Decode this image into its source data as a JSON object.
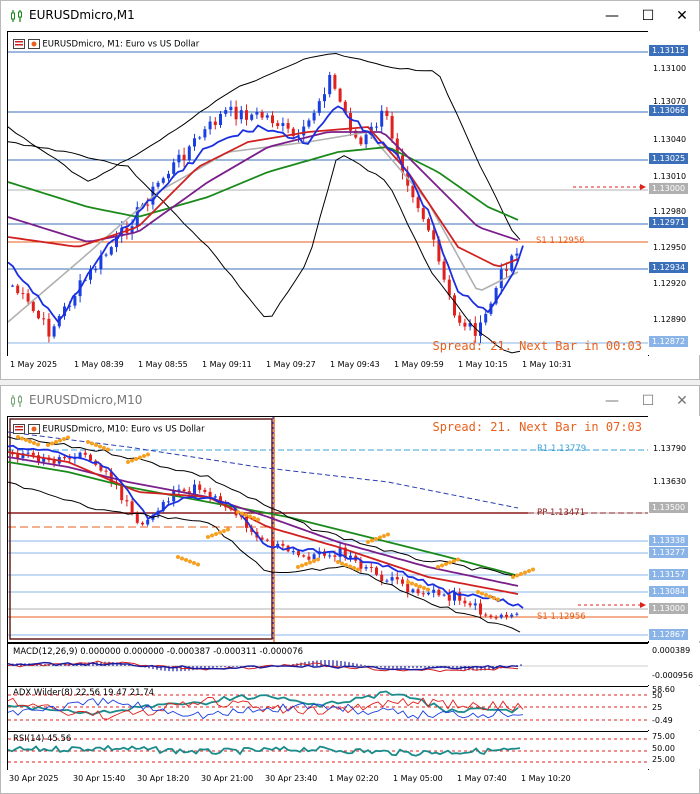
{
  "window1": {
    "title": "EURUSDmicro,M1",
    "header": "EURUSDmicro, M1:  Euro vs US Dollar",
    "spread": "Spread: 21. Next Bar in 00:03",
    "price_labels": [
      "1.13100",
      "1.13070",
      "1.13040",
      "1.13010",
      "1.12980",
      "1.12950",
      "1.12920",
      "1.12890"
    ],
    "price_tags": [
      {
        "text": "1.13115",
        "color": "#3c6fb9"
      },
      {
        "text": "1.13066",
        "color": "#3c6fb9"
      },
      {
        "text": "1.13025",
        "color": "#3c6fb9"
      },
      {
        "text": "1.13000",
        "color": "#b0b0b0"
      },
      {
        "text": "1.12971",
        "color": "#3c6fb9"
      },
      {
        "text": "1.12934",
        "color": "#3c6fb9"
      },
      {
        "text": "1.12872",
        "color": "#8ab4e8"
      }
    ],
    "s1_label": "S1 1.12956",
    "time_labels": [
      "1 May 2025",
      "1 May 08:39",
      "1 May 08:55",
      "1 May 09:11",
      "1 May 09:27",
      "1 May 09:43",
      "1 May 09:59",
      "1 May 10:15",
      "1 May 10:31"
    ]
  },
  "window2": {
    "title": "EURUSDmicro,M10",
    "header": "EURUSDmicro, M10:  Euro vs US Dollar",
    "spread": "Spread: 21. Next Bar in 07:03",
    "price_labels": [
      "1.13790",
      "1.13630"
    ],
    "r1_label": "R1 1.13779",
    "pp_label": "PP 1.13471",
    "s1_label": "S1 1.12956",
    "price_tags": [
      {
        "text": "1.13500",
        "color": "#b0b0b0"
      },
      {
        "text": "1.13338",
        "color": "#8ab4e8"
      },
      {
        "text": "1.13277",
        "color": "#8ab4e8"
      },
      {
        "text": "1.13157",
        "color": "#8ab4e8"
      },
      {
        "text": "1.13084",
        "color": "#8ab4e8"
      },
      {
        "text": "1.13000",
        "color": "#b0b0b0"
      },
      {
        "text": "1.12867",
        "color": "#8ab4e8"
      }
    ],
    "macd": {
      "label": "MACD(12,26,9) 0.000000 0.000000 -0.000387 -0.000311 -0.000076",
      "scale": [
        "0.000389",
        "-0.000956"
      ]
    },
    "adx": {
      "label": "ADX Wilder(8) 22.56 19.47 21.74",
      "scale": [
        "58.60",
        "50",
        "25",
        "-0.49"
      ]
    },
    "rsi": {
      "label": "RSI(14) 45.56",
      "scale": [
        "75.00",
        "50.00",
        "25.00"
      ]
    },
    "time_labels": [
      "30 Apr 2025",
      "30 Apr 15:40",
      "30 Apr 18:20",
      "30 Apr 21:00",
      "30 Apr 23:40",
      "1 May 02:20",
      "1 May 05:00",
      "1 May 07:40",
      "1 May 10:20"
    ]
  },
  "window_controls": {
    "minimize": "—",
    "maximize": "☐",
    "close": "✕"
  },
  "colors": {
    "bull": "#1a3fe0",
    "bear": "#e0201c",
    "ma_green": "#1a8a1a",
    "ma_purple": "#7a1f8a",
    "ma_red": "#d02020",
    "ma_blue": "#1a2fe0",
    "band": "#000000",
    "pivot": "#e8601c",
    "spread": "#e8601c"
  }
}
